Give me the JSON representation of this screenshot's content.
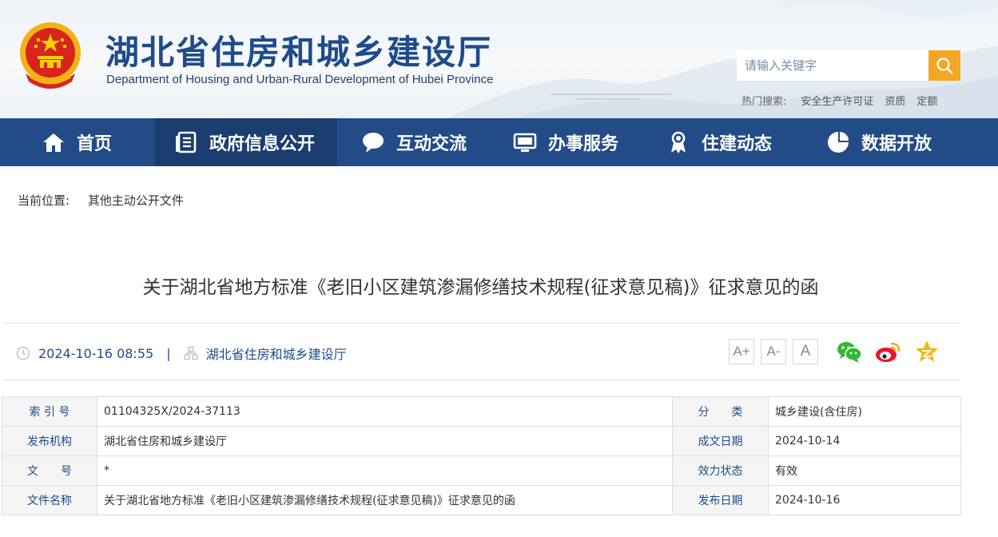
{
  "header": {
    "title": "湖北省住房和城乡建设厅",
    "subtitle": "Department of Housing and Urban-Rural Development of Hubei Province",
    "search_placeholder": "请输入关键字",
    "hot_label": "热门搜索:",
    "hot_links": [
      "安全生产许可证",
      "资质",
      "定额"
    ]
  },
  "nav": {
    "items": [
      {
        "label": "首页",
        "icon": "home-icon"
      },
      {
        "label": "政府信息公开",
        "icon": "document-list-icon",
        "active": true
      },
      {
        "label": "互动交流",
        "icon": "chat-bubble-icon"
      },
      {
        "label": "办事服务",
        "icon": "monitor-icon"
      },
      {
        "label": "住建动态",
        "icon": "person-badge-icon"
      },
      {
        "label": "数据开放",
        "icon": "pie-chart-icon"
      }
    ]
  },
  "breadcrumb": {
    "label": "当前位置:",
    "current": "其他主动公开文件"
  },
  "article": {
    "title": "关于湖北省地方标准《老旧小区建筑渗漏修缮技术规程(征求意见稿)》征求意见的函",
    "datetime": "2024-10-16 08:55",
    "separator": "|",
    "source": "湖北省住房和城乡建设厅",
    "font_sizes": [
      "A+",
      "A-",
      "A"
    ],
    "share": [
      "wechat-icon",
      "weibo-icon",
      "favorite-icon"
    ]
  },
  "info_table": {
    "rows": [
      {
        "k1": "索 引 号",
        "v1": "01104325X/2024-37113",
        "k2": "分　　类",
        "v2": "城乡建设(含住房)"
      },
      {
        "k1": "发布机构",
        "v1": "湖北省住房和城乡建设厅",
        "k2": "成文日期",
        "v2": "2024-10-14"
      },
      {
        "k1": "文　　号",
        "v1": "*",
        "k2": "效力状态",
        "v2": "有效"
      },
      {
        "k1": "文件名称",
        "v1": "关于湖北省地方标准《老旧小区建筑渗漏修缮技术规程(征求意见稿)》征求意见的函",
        "k2": "发布日期",
        "v2": "2024-10-16"
      }
    ]
  },
  "colors": {
    "nav_bg": "#234b87",
    "nav_active": "#1b3d70",
    "brand_blue": "#1e4b8c",
    "search_button": "#f5a623"
  }
}
